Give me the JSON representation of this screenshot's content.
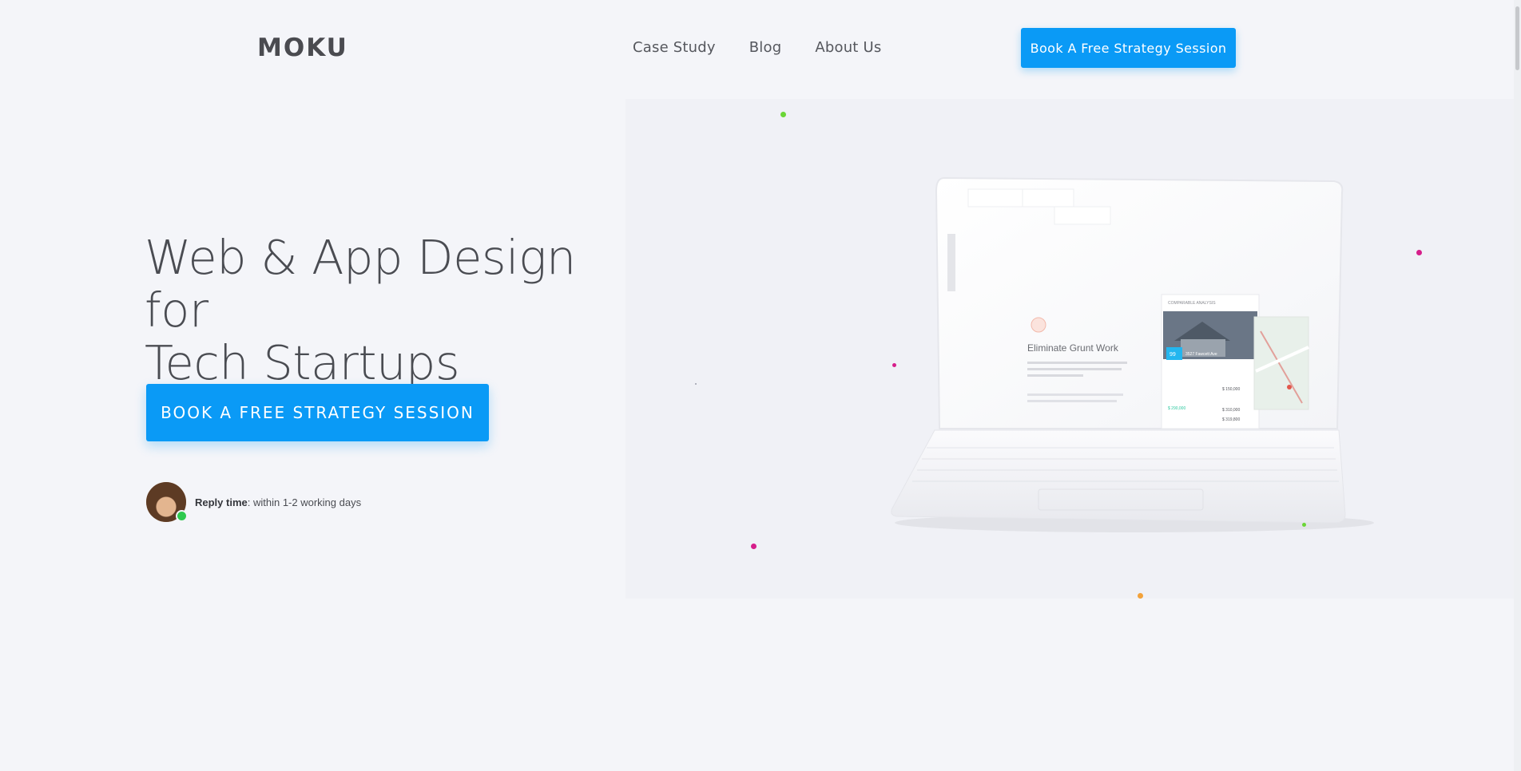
{
  "header": {
    "logo": "MOKU",
    "nav": [
      "Case Study",
      "Blog",
      "About Us"
    ],
    "cta_label": "Book A Free Strategy Session"
  },
  "hero": {
    "headline_line1": "Web & App Design for",
    "headline_line2": "Tech Startups",
    "cta_label": "BOOK A FREE STRATEGY SESSION",
    "reply_label": "Reply time",
    "reply_value": ": within 1-2 working days"
  },
  "laptop_screen": {
    "heading": "Eliminate Grunt Work",
    "card_title": "COMPARABLE ANALYSIS",
    "address": "3527 Fawcett Ave",
    "score": "99",
    "price_1": "$ 150,000",
    "price_2": "$ 310,000",
    "price_3": "$ 290,000",
    "price_4": "$ 319,800"
  },
  "colors": {
    "accent": "#0a9af6",
    "background": "#f4f5f9",
    "online": "#2ec94e"
  }
}
